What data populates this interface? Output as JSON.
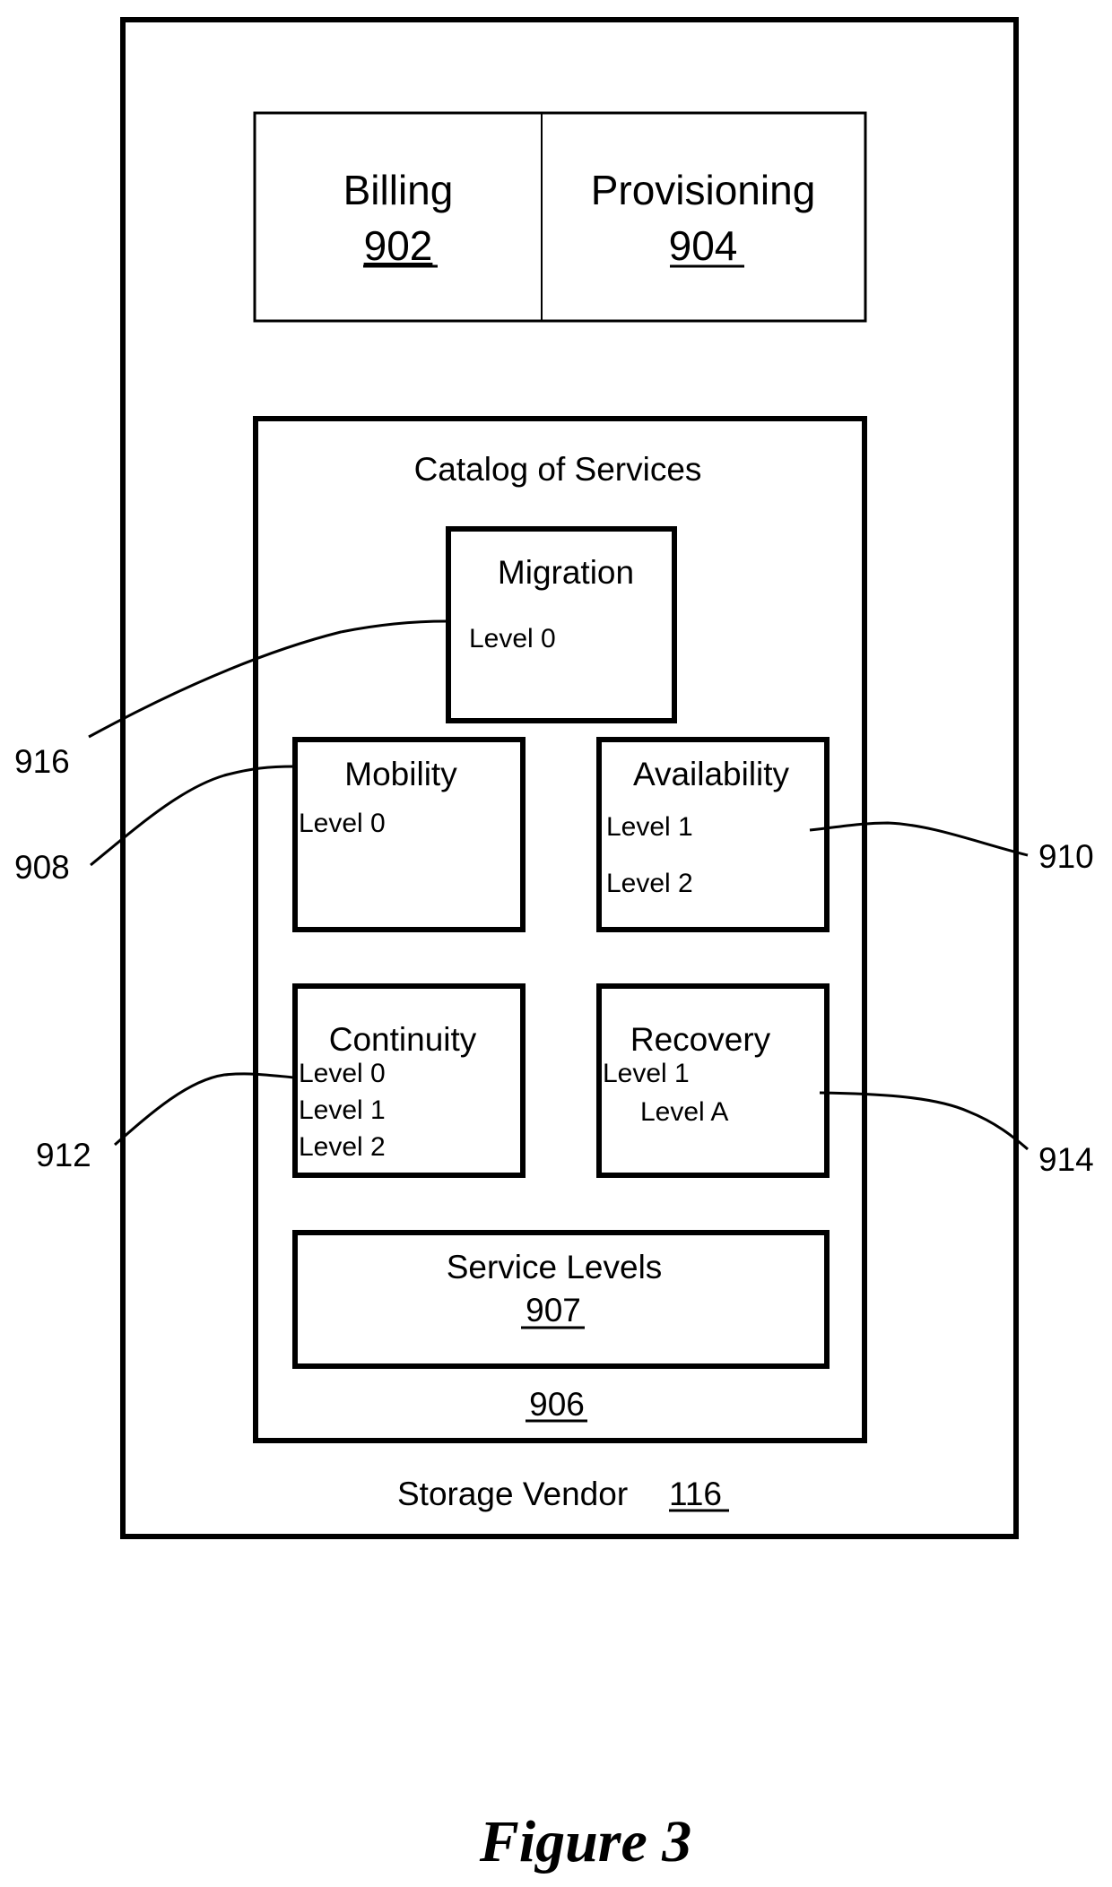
{
  "figure_caption": "Figure 3",
  "storage_vendor": {
    "label": "Storage Vendor ",
    "ref": "116"
  },
  "billing": {
    "label": "Billing",
    "ref": "902"
  },
  "provisioning": {
    "label": "Provisioning",
    "ref": "904"
  },
  "catalog": {
    "title": "Catalog of Services",
    "ref": "906",
    "services": {
      "migration": {
        "title": "Migration",
        "levels": [
          "Level 0"
        ],
        "ref": "916"
      },
      "mobility": {
        "title": "Mobility",
        "levels": [
          "Level 0"
        ],
        "ref": "908"
      },
      "availability": {
        "title": "Availability",
        "levels": [
          "Level 1",
          "Level 2"
        ],
        "ref": "910"
      },
      "continuity": {
        "title": "Continuity",
        "levels": [
          "Level 0",
          "Level 1",
          "Level 2"
        ],
        "ref": "912"
      },
      "recovery": {
        "title": "Recovery",
        "levels": [
          "Level 1",
          "Level A"
        ],
        "ref": "914"
      }
    },
    "service_levels": {
      "label": "Service Levels",
      "ref": "907"
    }
  }
}
